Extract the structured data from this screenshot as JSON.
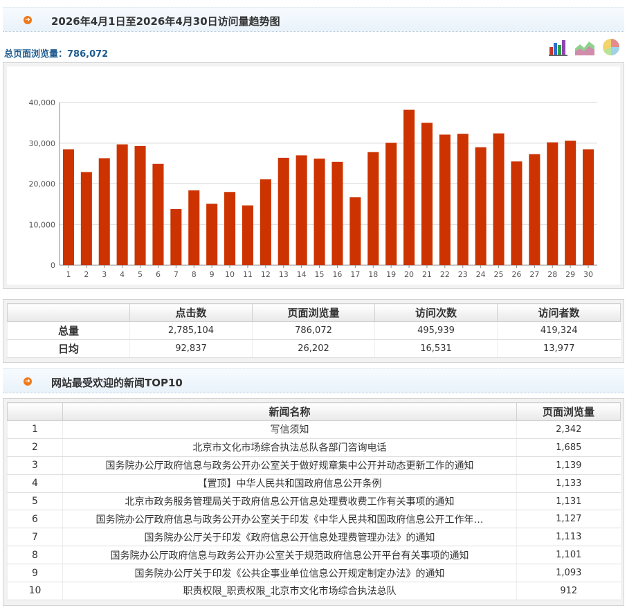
{
  "header1": {
    "title": "2026年4月1日至2026年4月30日访问量趋势图"
  },
  "total_line": "总页面浏览量：786,072",
  "chart_icons": [
    "bar-chart-icon",
    "area-chart-icon",
    "pie-chart-icon"
  ],
  "chart_data": {
    "type": "bar",
    "categories": [
      "1",
      "2",
      "3",
      "4",
      "5",
      "6",
      "7",
      "8",
      "9",
      "10",
      "11",
      "12",
      "13",
      "14",
      "15",
      "16",
      "17",
      "18",
      "19",
      "20",
      "21",
      "22",
      "23",
      "24",
      "25",
      "26",
      "27",
      "28",
      "29",
      "30"
    ],
    "values": [
      28500,
      22900,
      26300,
      29700,
      29300,
      24900,
      13800,
      18400,
      15100,
      18000,
      14700,
      21100,
      26400,
      27000,
      26200,
      25400,
      16700,
      27800,
      30100,
      38200,
      35000,
      32100,
      32300,
      29000,
      32400,
      25500,
      27300,
      30200,
      30600,
      28500
    ],
    "ylim": [
      0,
      40000
    ],
    "yticks": [
      "0",
      "10,000",
      "20,000",
      "30,000",
      "40,000"
    ],
    "ytick_values": [
      0,
      10000,
      20000,
      30000,
      40000
    ],
    "bar_color": "#cc3300",
    "grid": true
  },
  "stats": {
    "headers": [
      "点击数",
      "页面浏览量",
      "访问次数",
      "访问者数"
    ],
    "rows": [
      {
        "label": "总量",
        "values": [
          "2,785,104",
          "786,072",
          "495,939",
          "419,324"
        ]
      },
      {
        "label": "日均",
        "values": [
          "92,837",
          "26,202",
          "16,531",
          "13,977"
        ]
      }
    ]
  },
  "header2": {
    "title": "网站最受欢迎的新闻TOP10"
  },
  "top10": {
    "headers": [
      "新闻名称",
      "页面浏览量"
    ],
    "rows": [
      {
        "rank": "1",
        "title": "写信须知",
        "views": "2,342"
      },
      {
        "rank": "2",
        "title": "北京市文化市场综合执法总队各部门咨询电话",
        "views": "1,685"
      },
      {
        "rank": "3",
        "title": "国务院办公厅政府信息与政务公开办公室关于做好规章集中公开并动态更新工作的通知",
        "views": "1,139"
      },
      {
        "rank": "4",
        "title": "【置顶】中华人民共和国政府信息公开条例",
        "views": "1,133"
      },
      {
        "rank": "5",
        "title": "北京市政务服务管理局关于政府信息公开信息处理费收费工作有关事项的通知",
        "views": "1,131"
      },
      {
        "rank": "6",
        "title": "国务院办公厅政府信息与政务公开办公室关于印发《中华人民共和国政府信息公开工作年…",
        "views": "1,127"
      },
      {
        "rank": "7",
        "title": "国务院办公厅关于印发《政府信息公开信息处理费管理办法》的通知",
        "views": "1,113"
      },
      {
        "rank": "8",
        "title": "国务院办公厅政府信息与政务公开办公室关于规范政府信息公开平台有关事项的通知",
        "views": "1,101"
      },
      {
        "rank": "9",
        "title": "国务院办公厅关于印发《公共企事业单位信息公开规定制定办法》的通知",
        "views": "1,093"
      },
      {
        "rank": "10",
        "title": "职责权限_职责权限_北京市文化市场综合执法总队",
        "views": "912"
      }
    ]
  }
}
